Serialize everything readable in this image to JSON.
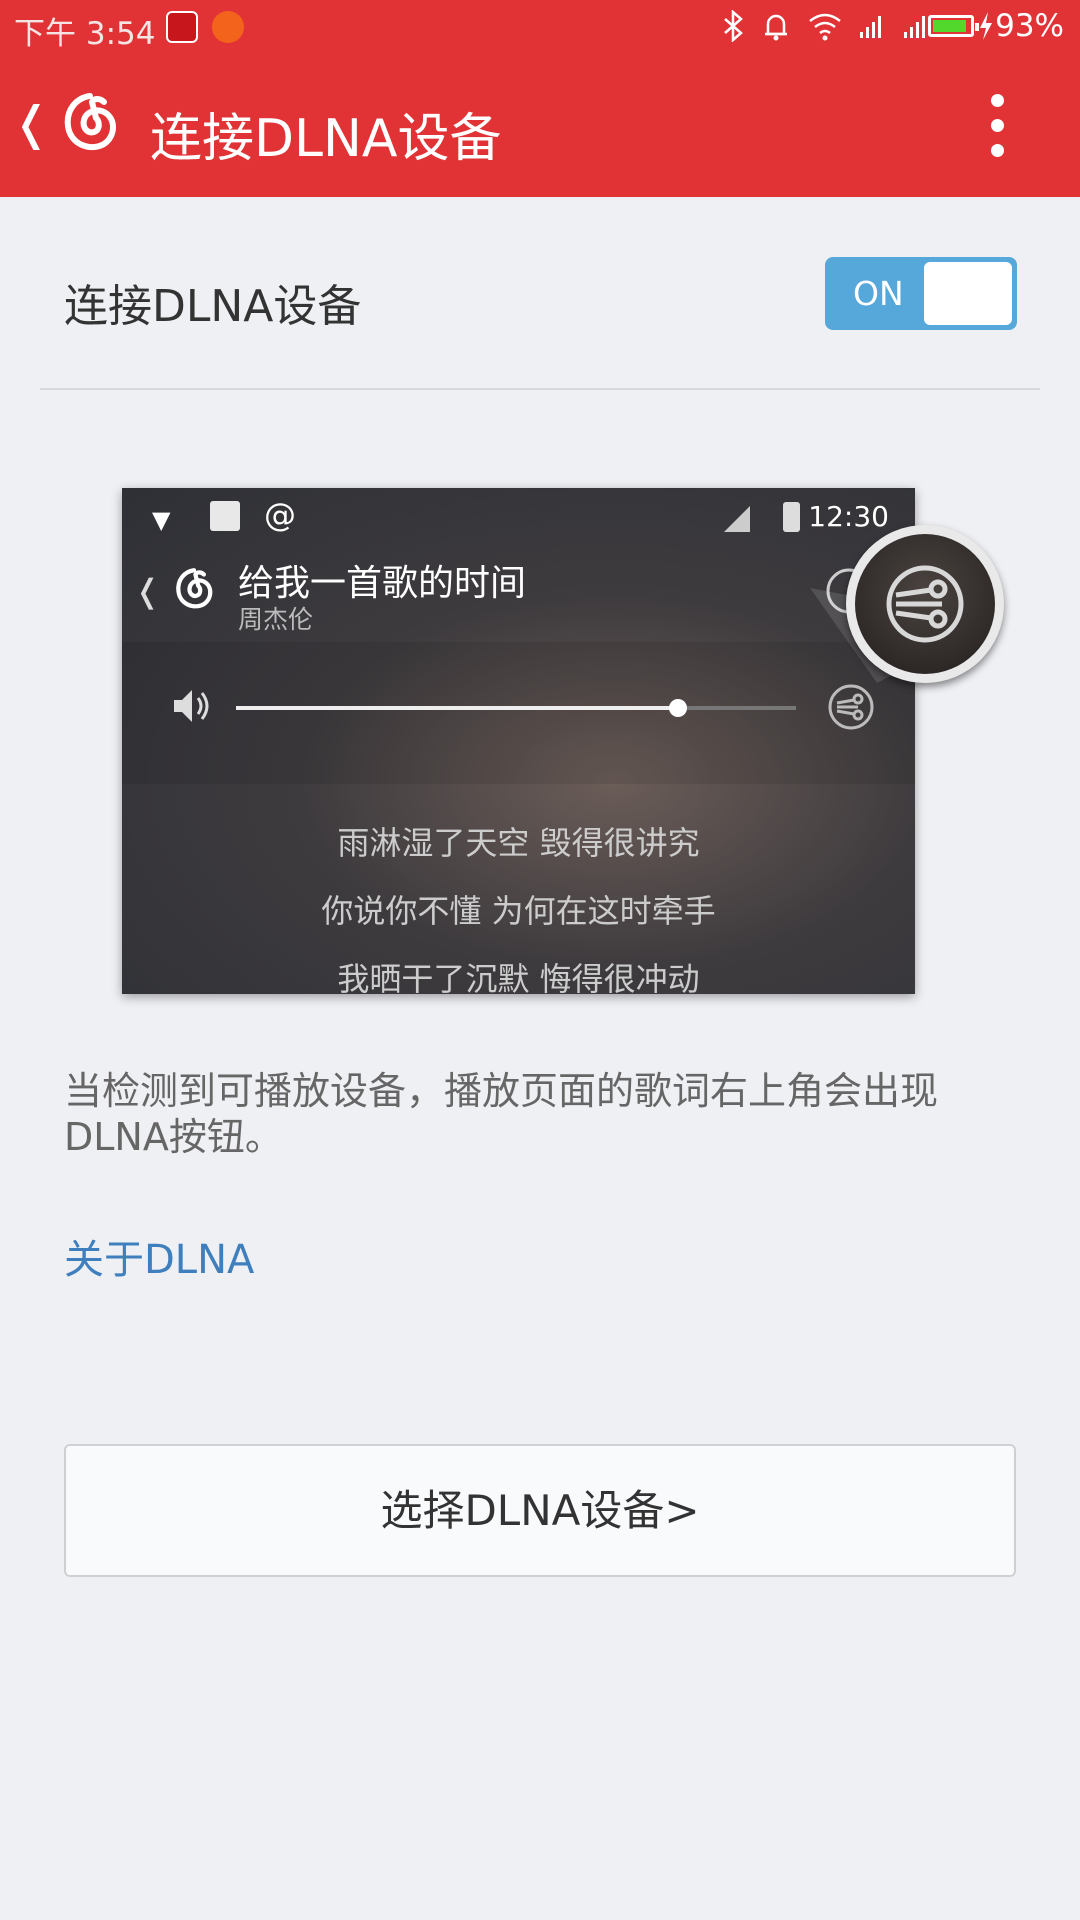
{
  "status_bar": {
    "time": "下午 3:54",
    "battery_percent": "93%",
    "battery_level": 0.93,
    "icons": [
      "netease-music-icon",
      "crop-app-icon",
      "bluetooth-icon",
      "alarm-icon",
      "wifi-icon",
      "signal-icon",
      "signal-icon",
      "battery-icon",
      "charging-icon"
    ]
  },
  "toolbar": {
    "back_glyph": "❬",
    "title": "连接DLNA设备"
  },
  "setting": {
    "label": "连接DLNA设备",
    "toggle_label": "ON",
    "toggle_on": true
  },
  "preview": {
    "time": "12:30",
    "back_glyph": "❬",
    "song_title": "给我一首歌的时间",
    "artist": "周杰伦",
    "volume_level": 0.79,
    "lyrics": [
      "雨淋湿了天空 毁得很讲究",
      "你说你不懂 为何在这时牵手",
      "我晒干了沉默 悔得很冲动"
    ]
  },
  "description": "当检测到可播放设备，播放页面的歌词右上角会出现DLNA按钮。",
  "about_link": "关于DLNA",
  "select_button": "选择DLNA设备>",
  "colors": {
    "brand_red": "#e13335",
    "toggle_blue": "#56a8da",
    "link_blue": "#3f7fbd",
    "background": "#eff0f4"
  }
}
